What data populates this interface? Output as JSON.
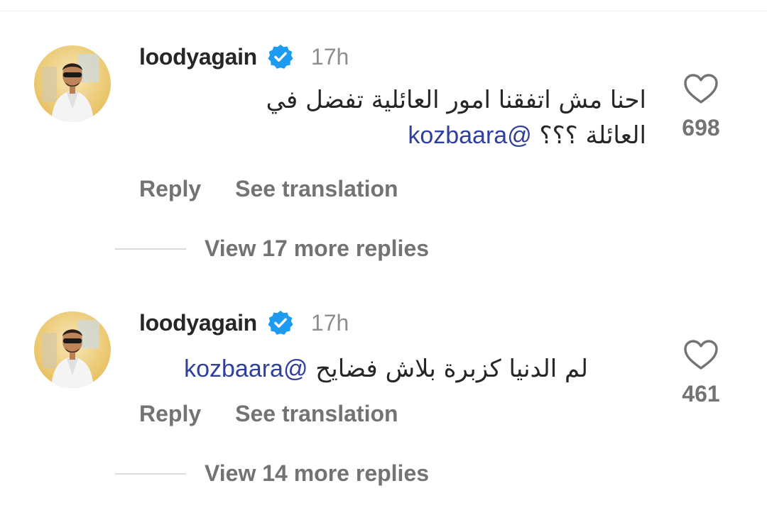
{
  "comments": [
    {
      "username": "loodyagain",
      "verified": true,
      "time": "17h",
      "text_line1": "احنا مش اتفقنا امور العائلية تفضل في",
      "text_line2": "العائلة ؟؟؟",
      "mention": "@kozbaara",
      "reply_label": "Reply",
      "translate_label": "See translation",
      "likes": "698",
      "view_replies": "View 17 more replies"
    },
    {
      "username": "loodyagain",
      "verified": true,
      "time": "17h",
      "text_line1": "لم الدنيا كزبرة بلاش فضايح",
      "mention": "@kozbaara",
      "reply_label": "Reply",
      "translate_label": "See translation",
      "likes": "461",
      "view_replies": "View 14 more replies"
    }
  ],
  "colors": {
    "verified_badge": "#1d9bf0",
    "mention": "#2f3f9e",
    "secondary_text": "#737373"
  },
  "icons": {
    "verified": "verified-badge-icon",
    "like": "heart-outline-icon"
  }
}
